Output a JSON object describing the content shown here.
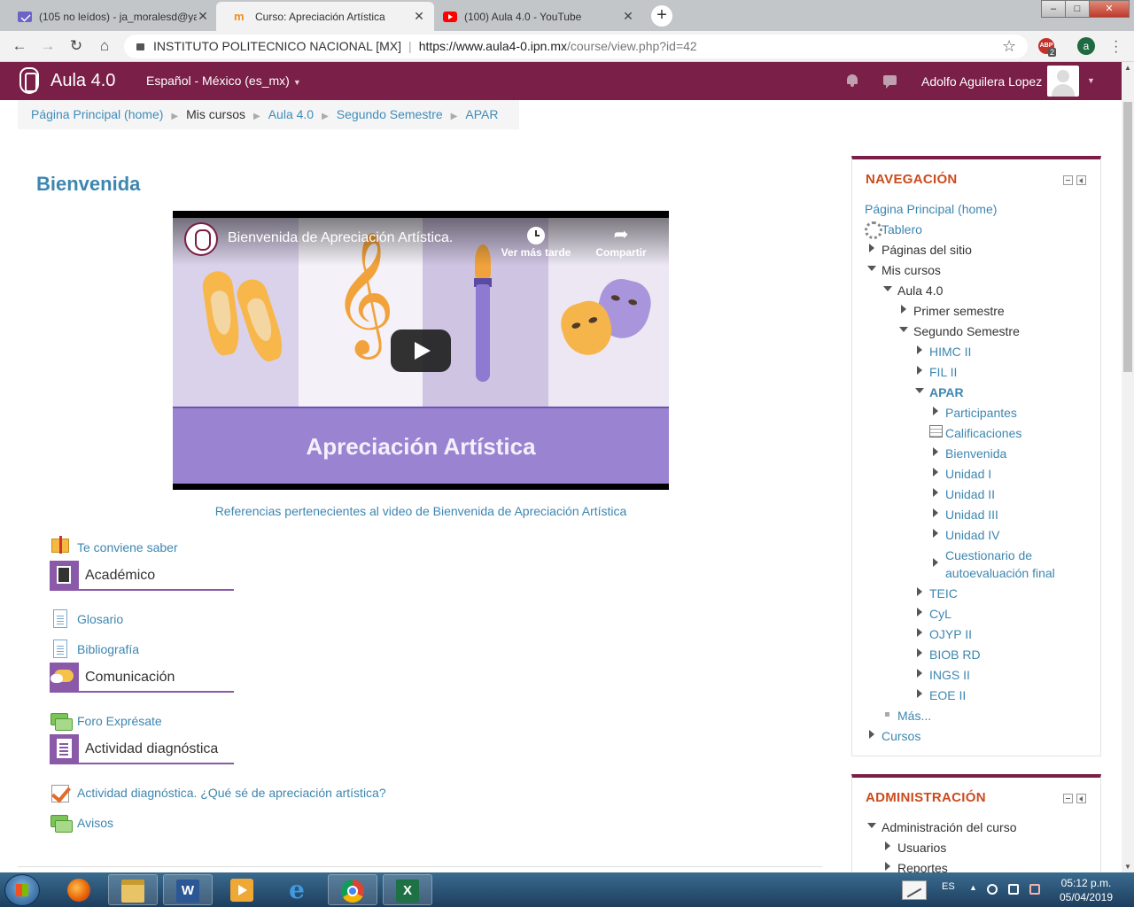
{
  "browser": {
    "tabs": [
      {
        "title": "(105 no leídos) - ja_moralesd@ya",
        "icon": "mail-icon",
        "active": false
      },
      {
        "title": "Curso: Apreciación Artística",
        "icon": "moodle-icon",
        "active": true
      },
      {
        "title": "(100) Aula 4.0 - YouTube",
        "icon": "youtube-icon",
        "active": false
      }
    ],
    "tab_close": "✕",
    "new_tab": "+",
    "window_controls": {
      "minimize": "–",
      "maximize": "□",
      "close": "✕"
    },
    "address": {
      "org": "INSTITUTO POLITECNICO NACIONAL [MX]",
      "separator": "|",
      "host": "https://www.aula4-0.ipn.mx",
      "path": "/course/view.php?id=42"
    },
    "extension_badge": "2",
    "extension_label": "ABP",
    "profile_initial": "a"
  },
  "navbar": {
    "brand": "Aula 4.0",
    "language": "Español - México (es_mx)",
    "user_name": "Adolfo Aguilera Lopez"
  },
  "breadcrumb": {
    "items": [
      {
        "label": "Página Principal (home)",
        "link": true
      },
      {
        "label": "Mis cursos",
        "link": false
      },
      {
        "label": "Aula 4.0",
        "link": true
      },
      {
        "label": "Segundo Semestre",
        "link": true
      },
      {
        "label": "APAR",
        "link": true
      }
    ],
    "separator": "▶"
  },
  "main": {
    "title": "Bienvenida",
    "video": {
      "title": "Bienvenida de Apreciación Artística.",
      "watch_later": "Ver más tarde",
      "share": "Compartir",
      "subtitle": "Apreciación Artística"
    },
    "video_caption": "Referencias pertenecientes al video de Bienvenida de Apreciación Artística",
    "items": {
      "te_conviene": "Te conviene saber",
      "academico": "Académico",
      "glosario": "Glosario",
      "bibliografia": "Bibliografía",
      "comunicacion": "Comunicación",
      "foro": "Foro Exprésate",
      "actividad_diag": "Actividad diagnóstica",
      "actividad_link": "Actividad diagnóstica. ¿Qué sé de apreciación artística?",
      "avisos": "Avisos"
    }
  },
  "navigation": {
    "title": "NAVEGACIÓN",
    "home": "Página Principal (home)",
    "dashboard": "Tablero",
    "site_pages": "Páginas del sitio",
    "my_courses": "Mis cursos",
    "aula": "Aula 4.0",
    "primer": "Primer semestre",
    "segundo": "Segundo Semestre",
    "himc": "HIMC II",
    "fil": "FIL II",
    "apar": "APAR",
    "participantes": "Participantes",
    "calificaciones": "Calificaciones",
    "bienvenida": "Bienvenida",
    "unidad1": "Unidad I",
    "unidad2": "Unidad II",
    "unidad3": "Unidad III",
    "unidad4": "Unidad IV",
    "cuestionario_1": "Cuestionario de",
    "cuestionario_2": "autoevaluación final",
    "teic": "TEIC",
    "cyl": "CyL",
    "ojyp": "OJYP II",
    "biob": "BIOB RD",
    "ings": "INGS II",
    "eoe": "EOE II",
    "mas": "Más...",
    "cursos": "Cursos"
  },
  "administration": {
    "title": "ADMINISTRACIÓN",
    "course_admin": "Administración del curso",
    "usuarios": "Usuarios",
    "reportes": "Reportes"
  },
  "taskbar": {
    "language": "ES",
    "time": "05:12 p.m.",
    "date": "05/04/2019",
    "word_letter": "W",
    "excel_letter": "X",
    "ie_letter": "e"
  }
}
